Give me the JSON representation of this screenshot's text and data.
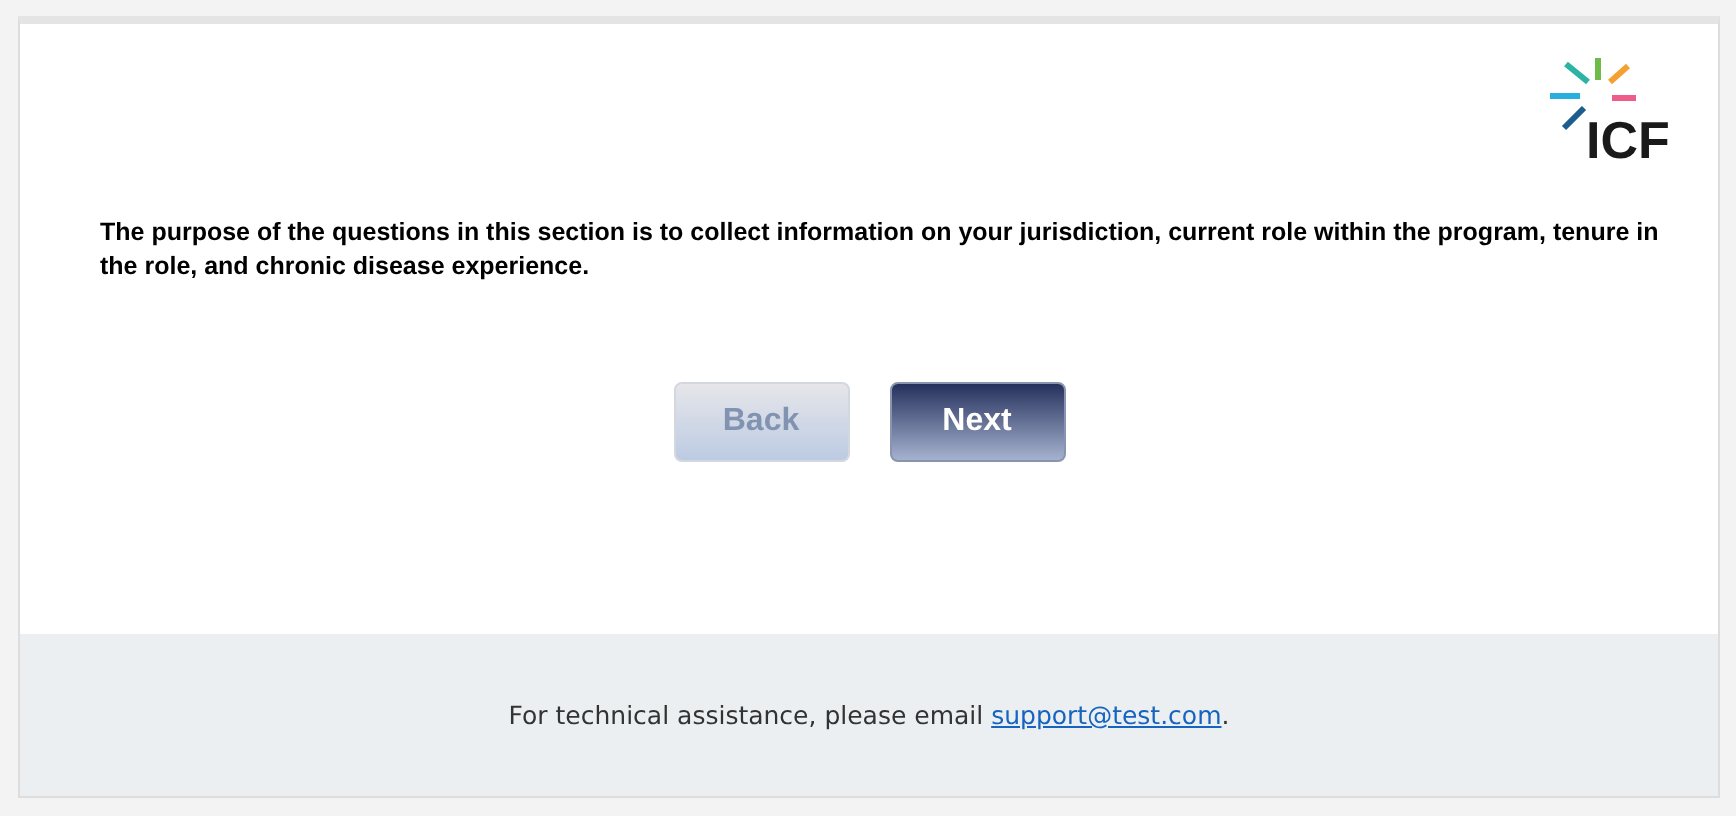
{
  "logo": {
    "text": "ICF"
  },
  "intro": "The purpose of the questions in this section is to collect information on your jurisdiction, current role within the program, tenure in the role, and chronic disease experience.",
  "buttons": [
    {
      "label": "Back",
      "disabled": true
    },
    {
      "label": "Next",
      "disabled": false
    }
  ],
  "footer": {
    "text": "For technical assistance, please email ",
    "link": "support@test.com",
    "suffix": "."
  }
}
